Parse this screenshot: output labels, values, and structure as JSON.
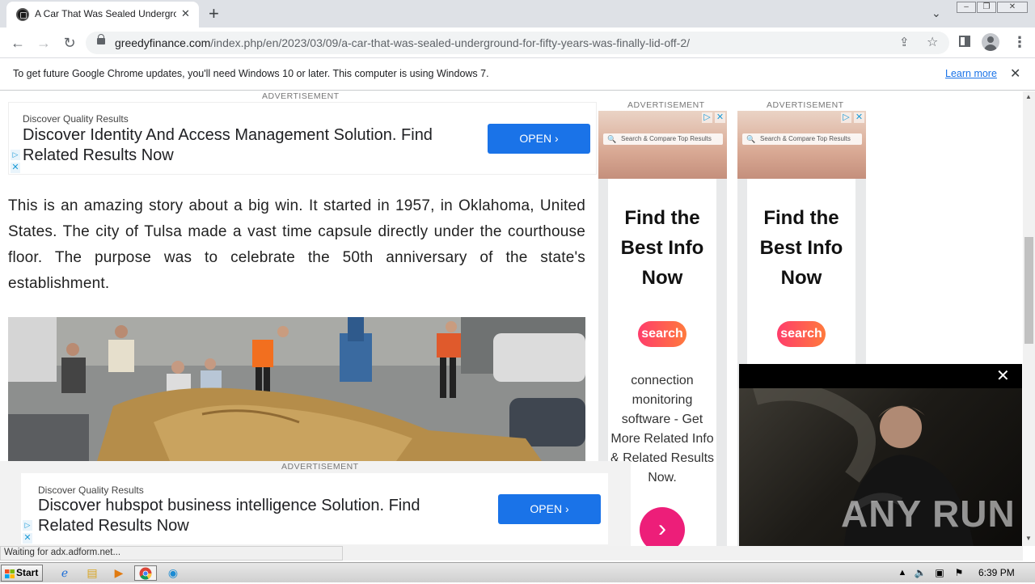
{
  "browser": {
    "tab_title": "A Car That Was Sealed Undergroun",
    "url_domain": "greedyfinance.com",
    "url_path": "/index.php/en/2023/03/09/a-car-that-was-sealed-underground-for-fifty-years-was-finally-lid-off-2/",
    "new_tab_glyph": "+",
    "close_glyph": "✕",
    "search_tabs_glyph": "⌄"
  },
  "infobar": {
    "message": "To get future Google Chrome updates, you'll need Windows 10 or later. This computer is using Windows 7.",
    "learn_more": "Learn more"
  },
  "ads": {
    "label": "ADVERTISEMENT",
    "top": {
      "brand": "Discover Quality Results",
      "headline": "Discover Identity And Access Management Solution. Find Related Results Now",
      "button": "OPEN"
    },
    "bottom": {
      "brand": "Discover Quality Results",
      "headline": "Discover hubspot business intelligence Solution. Find Related Results Now",
      "button": "OPEN"
    },
    "sky": {
      "search_placeholder": "Search & Compare Top Results",
      "headline": "Find the Best Info Now",
      "logo": "search",
      "body": "connection monitoring software - Get More Related Info & Related Results Now."
    }
  },
  "article": {
    "paragraph": "This is an amazing story about a big win. It started in 1957, in Oklahoma, United States. The city of Tulsa made a vast time capsule directly under the courthouse floor. The purpose was to celebrate the 50th anniversary of the state's establishment."
  },
  "video": {
    "watermark": "ANY RUN"
  },
  "status": {
    "text": "Waiting for adx.adform.net..."
  },
  "taskbar": {
    "start": "Start",
    "clock": "6:39 PM"
  }
}
